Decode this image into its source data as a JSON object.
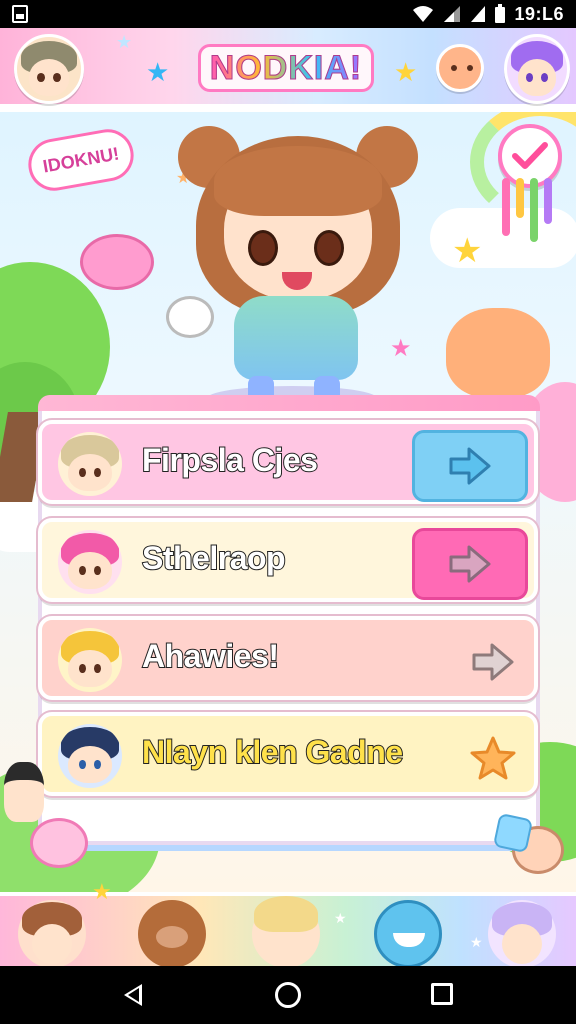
{
  "status_bar": {
    "time": "19:L6"
  },
  "header": {
    "title": "NODKIA!",
    "colors": {
      "pink": "#ff58b5",
      "blue": "#36c4f5",
      "purple": "#a56cff"
    }
  },
  "hero": {
    "speech_bubble": "IDOKNU!",
    "check_icon": "checkmark-icon"
  },
  "menu": {
    "items": [
      {
        "label": "Firpsla Cjes",
        "button_color": "#7fd0f5",
        "row_color": "#ffc6e3",
        "arrow_icon": "arrow-right-icon"
      },
      {
        "label": "Sthelraop",
        "button_color": "#ff6ab5",
        "row_color": "#fff6dc",
        "arrow_icon": "arrow-right-icon"
      },
      {
        "label": "Ahawies!",
        "button_color": "transparent",
        "row_color": "#ffd2cc",
        "arrow_icon": "arrow-right-icon"
      },
      {
        "label": "Nlayn klen Gadne",
        "button_color": "transparent",
        "row_color": "#fff3c2",
        "arrow_icon": "star-icon"
      }
    ]
  },
  "bottom_nav": {
    "items": [
      {
        "name": "brunette-girl-avatar"
      },
      {
        "name": "bear-avatar"
      },
      {
        "name": "blonde-boy-avatar"
      },
      {
        "name": "blue-cat-avatar"
      },
      {
        "name": "lavender-girl-avatar"
      }
    ]
  }
}
